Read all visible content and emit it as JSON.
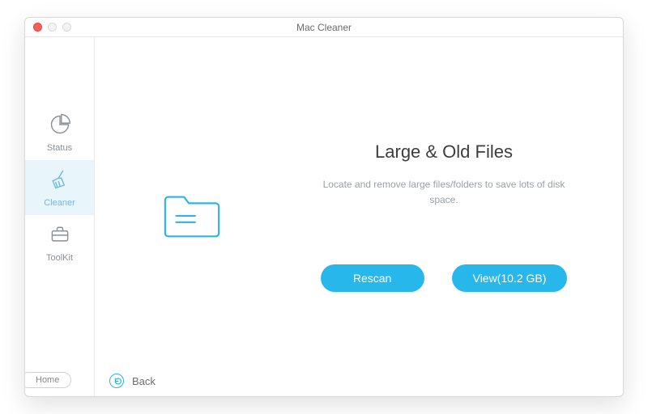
{
  "window": {
    "title": "Mac Cleaner"
  },
  "sidebar": {
    "items": [
      {
        "label": "Status"
      },
      {
        "label": "Cleaner"
      },
      {
        "label": "ToolKit"
      }
    ],
    "home_label": "Home"
  },
  "back": {
    "label": "Back"
  },
  "panel": {
    "heading": "Large & Old Files",
    "description": "Locate and remove large files/folders to save lots of disk space.",
    "rescan_label": "Rescan",
    "view_label": "View(10.2 GB)"
  },
  "colors": {
    "accent": "#28b7ea"
  }
}
